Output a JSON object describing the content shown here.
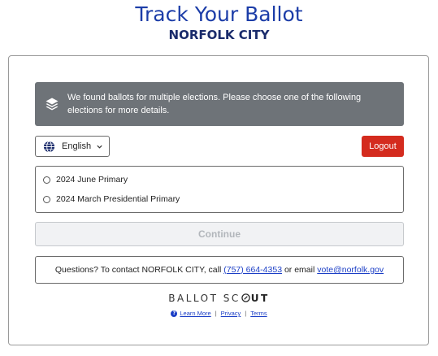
{
  "header": {
    "title": "Track Your Ballot",
    "subtitle": "NORFOLK CITY"
  },
  "alert": {
    "icon": "layers-icon",
    "message": "We found ballots for multiple elections. Please choose one of the following elections for more details."
  },
  "language": {
    "icon": "globe-icon",
    "selected": "English",
    "chevron": "chevron-down-icon"
  },
  "logout_label": "Logout",
  "elections": [
    {
      "label": "2024 June Primary",
      "selected": false
    },
    {
      "label": "2024 March Presidential Primary",
      "selected": false
    }
  ],
  "continue_label": "Continue",
  "contact": {
    "prefix": "Questions? To contact NORFOLK CITY, call",
    "phone": "(757) 664-4353",
    "middle": "or email",
    "email": "vote@norfolk.gov"
  },
  "brand": {
    "part1": "BALLOT SC",
    "part2": "UT"
  },
  "footer": {
    "learn_more": "Learn More",
    "privacy": "Privacy",
    "terms": "Terms",
    "separator": "|"
  },
  "colors": {
    "title": "#1c3da8",
    "alert_bg": "#6e7378",
    "logout_bg": "#d42b1e",
    "link": "#1b3ec6"
  }
}
